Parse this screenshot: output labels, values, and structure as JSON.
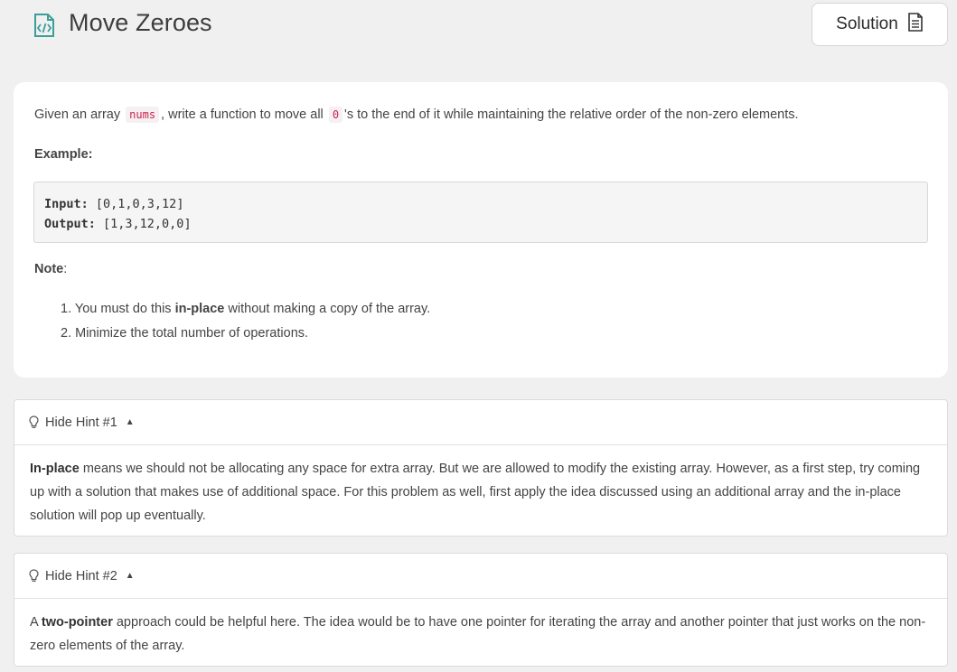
{
  "header": {
    "title": "Move Zeroes",
    "title_icon": "code-file-icon",
    "solution_label": "Solution",
    "solution_icon": "document-icon"
  },
  "problem": {
    "desc_pre": "Given an array",
    "desc_code1": "nums",
    "desc_mid": ", write a function to move all",
    "desc_code2": "0",
    "desc_post": "'s to the end of it while maintaining the relative order of the non-zero elements.",
    "example_label": "Example:",
    "input_label": "Input:",
    "input_value": " [0,1,0,3,12]",
    "output_label": "Output:",
    "output_value": " [1,3,12,0,0]",
    "note_label": "Note",
    "note_colon": ":",
    "notes": [
      {
        "num": "1.",
        "pre": "You must do this",
        "bold": "in-place",
        "post": "without making a copy of the array."
      },
      {
        "num": "2.",
        "text": "Minimize the total number of operations."
      }
    ]
  },
  "hints": [
    {
      "label": "Hide Hint #1",
      "bold": "In-place",
      "text": " means we should not be allocating any space for extra array. But we are allowed to modify the existing array. However, as a first step, try coming up with a solution that makes use of additional space. For this problem as well, first apply the idea discussed using an additional array and the in-place solution will pop up eventually."
    },
    {
      "label": "Hide Hint #2",
      "pre": "A",
      "bold": "two-pointer",
      "text": " approach could be helpful here. The idea would be to have one pointer for iterating the array and another pointer that just works on the non-zero elements of the array."
    }
  ],
  "colors": {
    "background": "#f0f0f0",
    "card": "#ffffff",
    "icon_teal": "#3a9e9b",
    "inline_code": "#c7254e"
  }
}
